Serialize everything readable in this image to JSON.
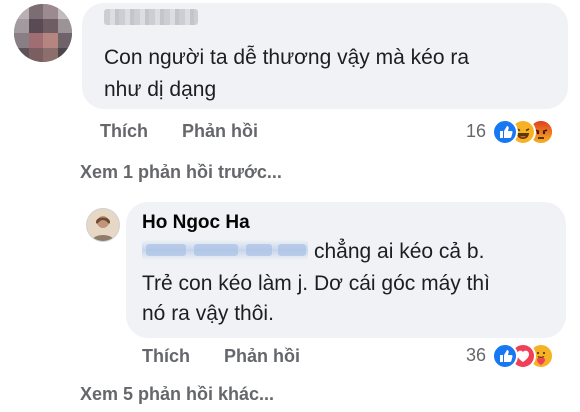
{
  "comment1": {
    "text_line1": "Con người ta dễ thương vậy mà kéo ra",
    "text_line2": "như dị dạng",
    "like_label": "Thích",
    "reply_label": "Phản hồi",
    "reaction_count": "16",
    "reactions": [
      "like-reaction-icon",
      "haha-reaction-icon",
      "angry-reaction-icon"
    ]
  },
  "view_previous_replies": "Xem 1 phản hồi trước...",
  "reply": {
    "author": "Ho Ngoc Ha",
    "text_line1": "chẳng ai kéo cả b.",
    "text_line2": "Trẻ con kéo làm j. Dơ cái góc máy thì",
    "text_line3": "nó ra vậy thôi.",
    "like_label": "Thích",
    "reply_label": "Phản hồi",
    "reaction_count": "36",
    "reactions": [
      "like-reaction-icon",
      "love-reaction-icon",
      "care-reaction-icon"
    ]
  },
  "view_more_replies": "Xem 5 phản hồi khác...",
  "colors": {
    "bubble": "#f0f2f5",
    "secondary_text": "#65676b",
    "like_blue": "#1877f2",
    "love_red": "#f33e58",
    "haha_yellow": "#f7b125"
  }
}
